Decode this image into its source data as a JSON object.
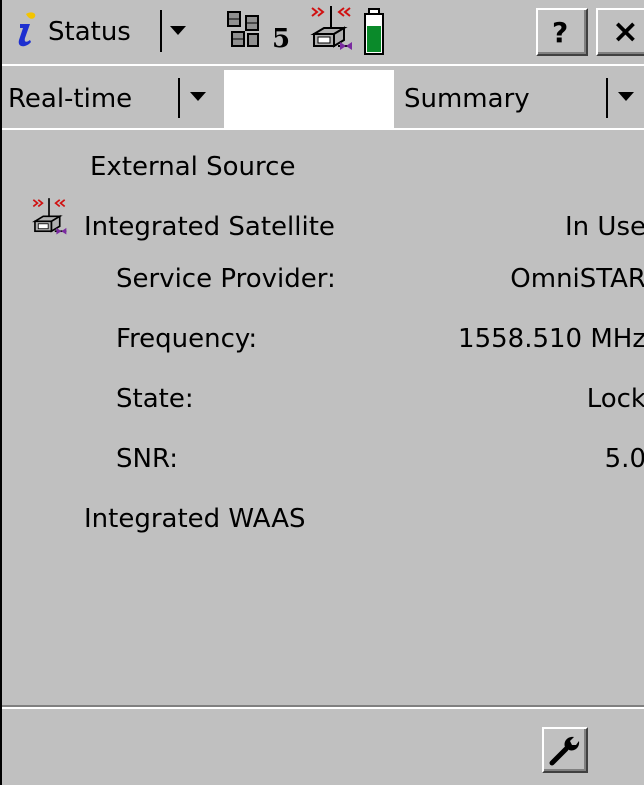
{
  "titlebar": {
    "app_label": "Status",
    "satellite_count": "5",
    "help_label": "?",
    "close_label": "×",
    "icons": {
      "app": "info-icon",
      "satellites": "satellite-icon",
      "radio": "radio-antenna-icon",
      "battery": "battery-icon"
    }
  },
  "tabs": {
    "left_dropdown_value": "Real-time",
    "right_dropdown_value": "Summary"
  },
  "main": {
    "rows": [
      {
        "label": "External Source",
        "value": ""
      },
      {
        "label": "Integrated Satellite",
        "value": "In Use"
      },
      {
        "label": "Service Provider:",
        "value": "OmniSTAR"
      },
      {
        "label": "Frequency:",
        "value": "1558.510 MHz"
      },
      {
        "label": "State:",
        "value": "Lock"
      },
      {
        "label": "SNR:",
        "value": "5.0"
      },
      {
        "label": "Integrated WAAS",
        "value": ""
      }
    ]
  },
  "bottombar": {
    "settings_icon": "wrench-icon"
  },
  "colors": {
    "background": "#c0c0c0",
    "battery_fill": "#0a8a2a",
    "antenna_red": "#d01010",
    "info_blue": "#1d2fd0"
  }
}
